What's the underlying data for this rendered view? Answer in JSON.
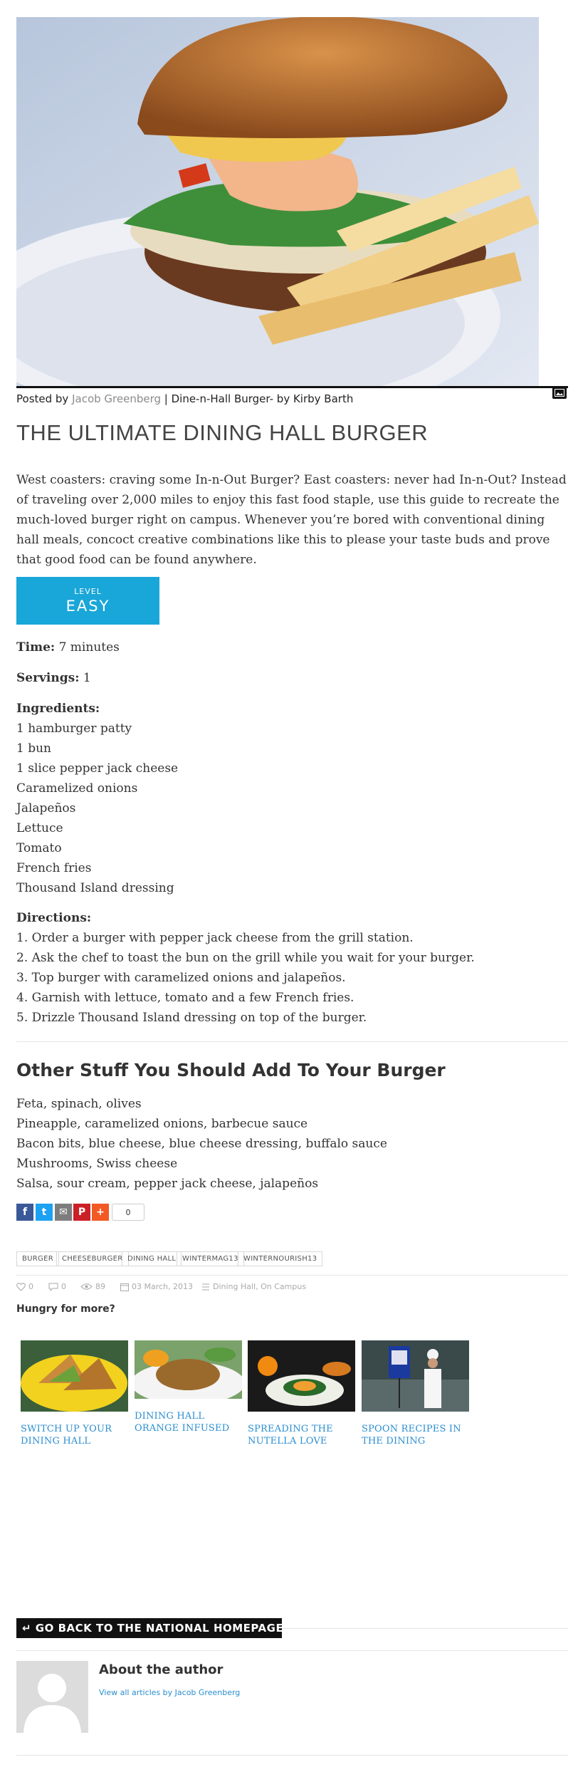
{
  "post": {
    "posted_prefix": "Posted by ",
    "author": "Jacob Greenberg",
    "posted_suffix": " | Dine-n-Hall Burger- by Kirby Barth",
    "title": "THE ULTIMATE DINING HALL BURGER",
    "intro": "West coasters: craving some In-n-Out Burger? East coasters: never had In-n-Out? Instead of traveling over 2,000 miles to enjoy this fast food staple, use this guide to recreate the much-loved burger right on campus. Whenever you’re bored with conventional dining hall meals, concoct creative combinations like this to please your taste buds and prove that good food can be found anywhere."
  },
  "level": {
    "label": "LEVEL",
    "value": "EASY"
  },
  "time": {
    "label": "Time:",
    "value": " 7 minutes"
  },
  "servings": {
    "label": "Servings:",
    "value": " 1"
  },
  "ingredients": {
    "label": "Ingredients:",
    "items": [
      "1 hamburger patty",
      "1 bun",
      "1 slice pepper jack cheese",
      "Caramelized onions",
      "Jalapeños",
      "Lettuce",
      "Tomato",
      "French fries",
      "Thousand Island dressing"
    ]
  },
  "directions": {
    "label": "Directions:",
    "items": [
      "1. Order a burger with pepper jack cheese from the grill station.",
      "2. Ask the chef to toast the bun on the grill while you wait for your burger.",
      "3. Top burger with caramelized onions and jalapeños.",
      "4. Garnish with lettuce, tomato and a few French fries.",
      "5. Drizzle Thousand Island dressing on top of the burger."
    ]
  },
  "other": {
    "heading": "Other Stuff You Should Add To Your Burger",
    "items": [
      "Feta, spinach, olives",
      "Pineapple, caramelized onions, barbecue sauce",
      "Bacon bits, blue cheese, blue cheese dressing, buffalo sauce",
      "Mushrooms, Swiss cheese",
      "Salsa, sour cream, pepper jack cheese, jalapeños"
    ]
  },
  "share": {
    "count": "0",
    "buttons": [
      {
        "icon": "facebook-icon",
        "glyph": "f",
        "color": "#3b5998"
      },
      {
        "icon": "twitter-icon",
        "glyph": "t",
        "color": "#1da1f2"
      },
      {
        "icon": "email-icon",
        "glyph": "✉",
        "color": "#7d7d7d"
      },
      {
        "icon": "pinterest-icon",
        "glyph": "P",
        "color": "#cb2027"
      },
      {
        "icon": "plus-icon",
        "glyph": "+",
        "color": "#f15a24"
      }
    ]
  },
  "tags": [
    "BURGER",
    "CHEESEBURGER",
    "DINING HALL",
    "WINTERMAG13",
    "WINTERNOURISH13"
  ],
  "meta": {
    "likes": "0",
    "comments": "0",
    "views": "89",
    "date": "03 March, 2013",
    "categories": "Dining Hall, On Campus"
  },
  "related": {
    "heading": "Hungry for more?",
    "items": [
      {
        "title": "SWITCH UP YOUR DINING HALL"
      },
      {
        "title": "DINING HALL ORANGE INFUSED"
      },
      {
        "title": "SPREADING THE NUTELLA LOVE"
      },
      {
        "title": "SPOON RECIPES IN THE DINING"
      }
    ]
  },
  "footer": {
    "home_button": "↵ GO BACK TO THE NATIONAL HOMEPAGE",
    "about_heading": "About the author",
    "about_link": "View all articles by Jacob Greenberg"
  },
  "colors": {
    "accent": "#19a6d8",
    "link": "#2a8ed0"
  }
}
